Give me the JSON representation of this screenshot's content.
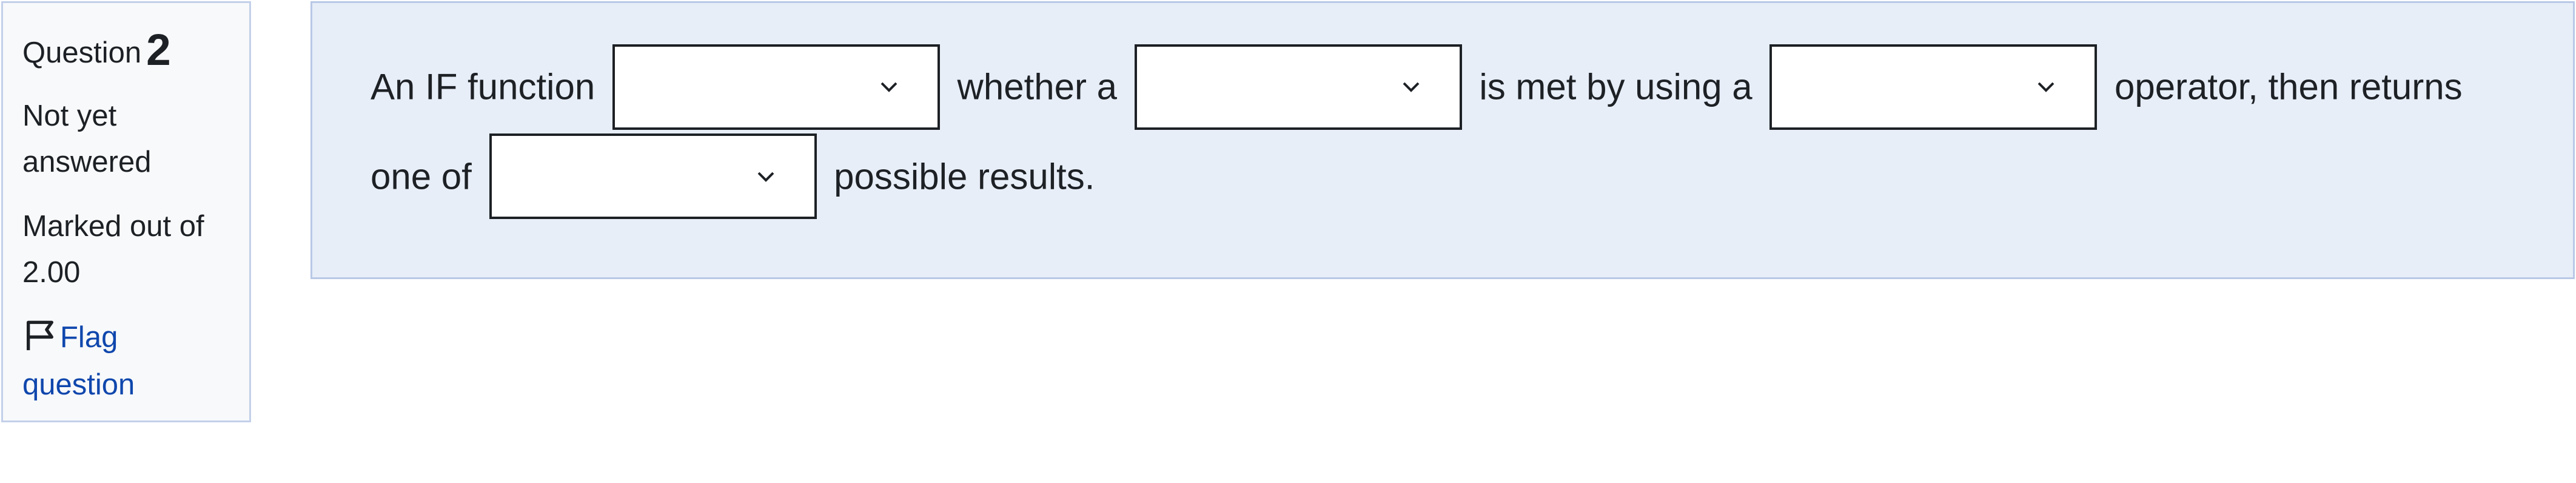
{
  "info": {
    "question_label": "Question",
    "question_number": "2",
    "state": "Not yet answered",
    "grade": "Marked out of 2.00",
    "flag_label": "Flag question"
  },
  "question": {
    "segments": [
      "An IF function",
      "whether a",
      "is met by using a",
      "operator, then returns",
      "one of",
      "possible results."
    ],
    "selects": [
      {
        "selected": ""
      },
      {
        "selected": ""
      },
      {
        "selected": ""
      },
      {
        "selected": ""
      }
    ]
  },
  "icons": {
    "flag": "flag-icon",
    "dropdown": "chevron-down-icon"
  },
  "colors": {
    "panel_bg": "#f8f9fa",
    "panel_border": "#c3d0ea",
    "content_bg": "#e7eef8",
    "content_border": "#b8c8e6",
    "link": "#0f47ad",
    "text": "#1d2125"
  }
}
